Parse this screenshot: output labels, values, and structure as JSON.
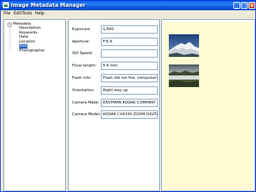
{
  "window": {
    "title": "Image Metadata Manager",
    "min_glyph": "_",
    "max_glyph": "□",
    "close_glyph": "×"
  },
  "menu": {
    "file": "File",
    "edit": "Edit",
    "tools": "Tools",
    "help": "Help"
  },
  "tree": {
    "expander": "−",
    "root": "Metadata",
    "items": [
      "Description",
      "Keywords",
      "Date",
      "Location",
      "Exif",
      "Photographer"
    ],
    "selected_index": 4
  },
  "properties": [
    {
      "label": "Exposure:",
      "value": "1/500"
    },
    {
      "label": "Aperture:",
      "value": "F/5.6"
    },
    {
      "label": "ISO Speed:",
      "value": ""
    },
    {
      "label": "Focal lenght:",
      "value": "5.6 mm"
    },
    {
      "label": "Flash info:",
      "value": "Flash did not fire, compulsory flash"
    },
    {
      "label": "Orientation:",
      "value": "Right way up"
    },
    {
      "label": "Camera Make:",
      "value": "EASTMAN KODAK COMPANY"
    },
    {
      "label": "Camera Model:",
      "value": "KODAK CX6330 ZOOM DIGITAL CAMERA"
    }
  ],
  "images": {
    "background_color": "#fffcd3",
    "thumbnails": [
      "mountain-landscape-thumbnail",
      "lake-landscape-thumbnail"
    ]
  }
}
